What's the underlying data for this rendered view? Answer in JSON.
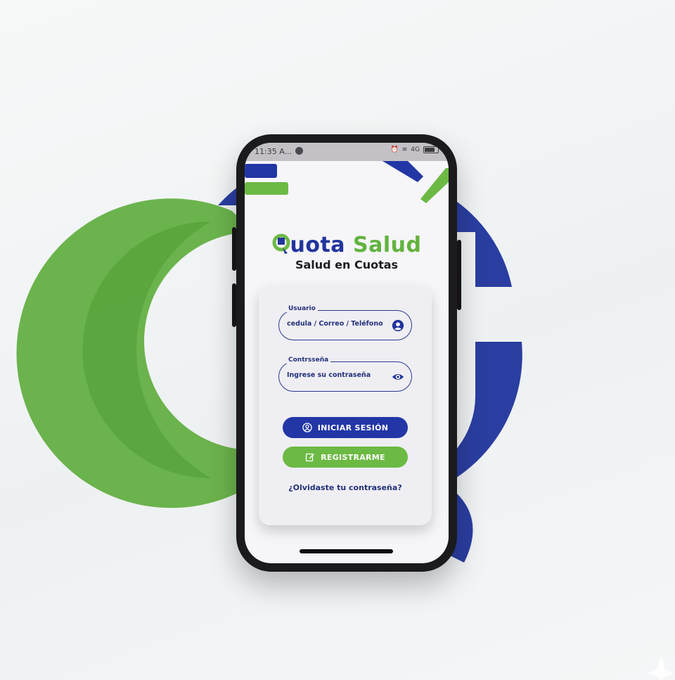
{
  "status_bar": {
    "time": "11:35 A...",
    "signal_text": "4G"
  },
  "brand": {
    "name_part1": "uota",
    "name_part2": "Salud",
    "tagline": "Salud en Cuotas",
    "colors": {
      "blue": "#2336a6",
      "green": "#6cb944"
    }
  },
  "login_form": {
    "user_field": {
      "label": "Usuario",
      "placeholder": "cedula / Correo / Teléfono",
      "icon": "user-circle-icon"
    },
    "password_field": {
      "label": "Contrsseña",
      "placeholder": "Ingrese su contraseña",
      "icon": "eye-icon"
    },
    "login_button": {
      "label": "INICIAR SESIÓN",
      "icon": "user-icon"
    },
    "register_button": {
      "label": "REGISTRARME",
      "icon": "edit-icon"
    },
    "forgot_link": "¿Olvidaste tu contraseña?"
  }
}
